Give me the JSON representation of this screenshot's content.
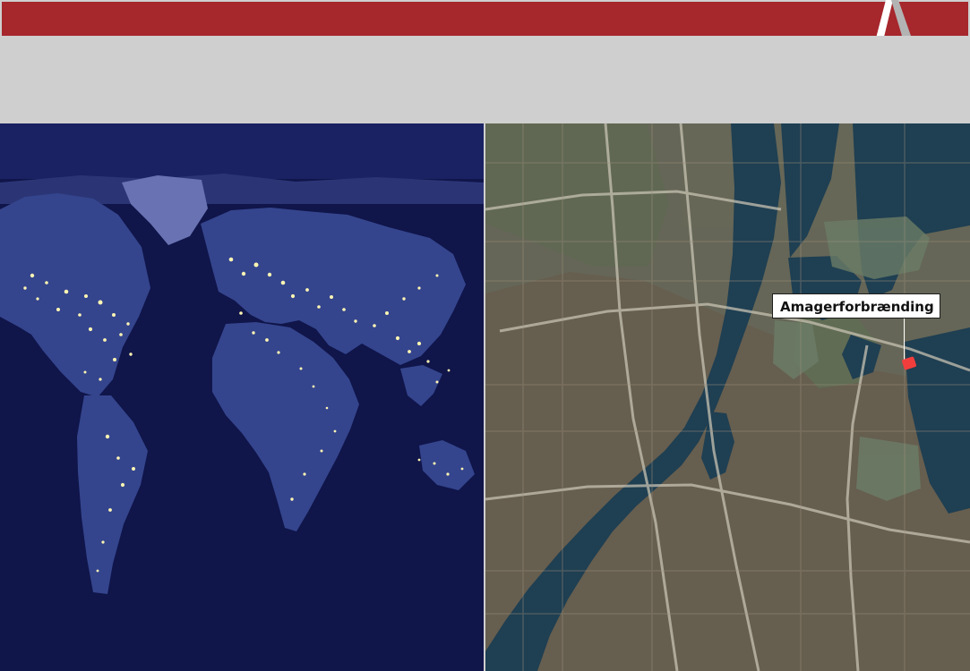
{
  "slide": {
    "accent_color": "#a6272c",
    "background_color": "#cfcfcf",
    "logo_icon": "stylized-a-logo"
  },
  "left_map": {
    "kind": "night-world-map",
    "ocean_color": "#10154a",
    "land_color": "#2f3f86",
    "lights_color": "#fff5b3"
  },
  "right_map": {
    "kind": "aerial-city-map",
    "water_color": "#1f3f52",
    "label_text": "Amagerforbrænding",
    "marker_color": "#f23d3d"
  }
}
